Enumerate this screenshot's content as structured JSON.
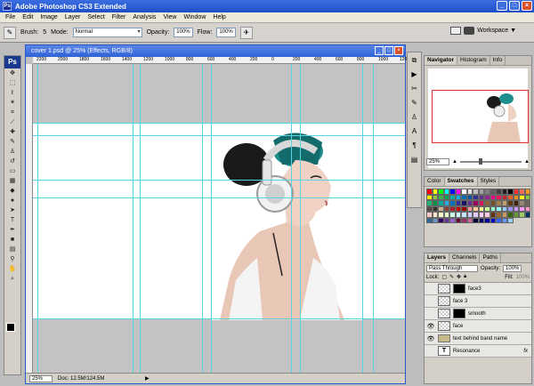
{
  "titlebar": {
    "app_icon_label": "Ps",
    "title": "Adobe Photoshop CS3 Extended",
    "minimize": "_",
    "maximize": "□",
    "close": "×"
  },
  "menu": [
    "File",
    "Edit",
    "Image",
    "Layer",
    "Select",
    "Filter",
    "Analysis",
    "View",
    "Window",
    "Help"
  ],
  "options": {
    "brush_label": "Brush:",
    "brush_size": "5",
    "mode_label": "Mode:",
    "mode_value": "Normal",
    "opacity_label": "Opacity:",
    "opacity_value": "100%",
    "flow_label": "Flow:",
    "flow_value": "100%",
    "workspace_label": "Workspace ▼"
  },
  "toolbox": {
    "logo": "Ps",
    "tools": [
      "move",
      "marquee",
      "lasso",
      "magic-wand",
      "crop",
      "slice",
      "healing",
      "brush",
      "stamp",
      "history-brush",
      "eraser",
      "gradient",
      "blur",
      "dodge",
      "path-select",
      "type",
      "pen",
      "shape",
      "notes",
      "eyedropper",
      "hand",
      "zoom"
    ]
  },
  "document": {
    "title": "cover 1.psd @ 25% (Effects, RGB/8)",
    "ruler_marks": [
      "2200",
      "2000",
      "1800",
      "1600",
      "1400",
      "1200",
      "1000",
      "800",
      "600",
      "400",
      "200",
      "0",
      "200",
      "400",
      "600",
      "800",
      "1000",
      "1200"
    ],
    "status_zoom": "25%",
    "status_doc": "Doc: 12.5M/124.5M"
  },
  "navigator": {
    "tabs": [
      "Navigator",
      "Histogram",
      "Info"
    ],
    "zoom": "25%"
  },
  "color_panel": {
    "tabs": [
      "Color",
      "Swatches",
      "Styles"
    ],
    "swatches": [
      "#ff0000",
      "#ffff00",
      "#00ff00",
      "#00ffff",
      "#0000ff",
      "#ff00ff",
      "#ffffff",
      "#e0e0e0",
      "#c0c0c0",
      "#a0a0a0",
      "#808080",
      "#606060",
      "#404040",
      "#202020",
      "#000000",
      "#ff3333",
      "#f26b5b",
      "#f7941d",
      "#fff200",
      "#8dc63f",
      "#39b54a",
      "#00a651",
      "#00a99d",
      "#00aeef",
      "#0072bc",
      "#0054a6",
      "#2e3192",
      "#662d91",
      "#92278f",
      "#ec008c",
      "#ed145b",
      "#c1272d",
      "#f15a24",
      "#f7931e",
      "#fcee21",
      "#8cc63f",
      "#22b573",
      "#009245",
      "#00a99d",
      "#29abe2",
      "#0071bc",
      "#2e3192",
      "#1b1464",
      "#662d91",
      "#9e005d",
      "#d4145a",
      "#8c6239",
      "#754c24",
      "#a67c52",
      "#c69c6d",
      "#603813",
      "#42210b",
      "#998675",
      "#736357",
      "#534741",
      "#362f2d",
      "#c7b299",
      "#8a3e2f",
      "#ad1f2f",
      "#cc0000",
      "#990000",
      "#ff9999",
      "#ffcc99",
      "#ffff99",
      "#ccff99",
      "#99ffcc",
      "#99ffff",
      "#99ccff",
      "#9999ff",
      "#cc99ff",
      "#ff99ff",
      "#ff99cc",
      "#ffcccc",
      "#ffe5cc",
      "#ffffcc",
      "#e5ffcc",
      "#ccffe5",
      "#ccffff",
      "#cce5ff",
      "#ccccff",
      "#e5ccff",
      "#ffccff",
      "#ffcce5",
      "#663300",
      "#996633",
      "#cc9966",
      "#336600",
      "#669933",
      "#99cc66",
      "#003366",
      "#336699",
      "#6699cc",
      "#330066",
      "#663399",
      "#9966cc",
      "#660033",
      "#993366",
      "#cc6699",
      "#000033",
      "#000066",
      "#000099",
      "#0000cc",
      "#3366ff",
      "#6699ff",
      "#99ccff"
    ]
  },
  "layers": {
    "tabs": [
      "Layers",
      "Channels",
      "Paths"
    ],
    "blend_mode": "Pass Through",
    "opacity_label": "Opacity:",
    "opacity_value": "100%",
    "lock_label": "Lock:",
    "fill_label": "Fill:",
    "fill_value": "100%",
    "rows": [
      {
        "name": "face3",
        "visible": false,
        "kind": "masked"
      },
      {
        "name": "face 3",
        "visible": false,
        "kind": "plain"
      },
      {
        "name": "smooth",
        "visible": false,
        "kind": "masked"
      },
      {
        "name": "face",
        "visible": true,
        "kind": "plain"
      },
      {
        "name": "text behind band name",
        "visible": true,
        "kind": "group"
      },
      {
        "name": "Resonance",
        "visible": false,
        "kind": "text",
        "fx": "fx"
      }
    ]
  }
}
